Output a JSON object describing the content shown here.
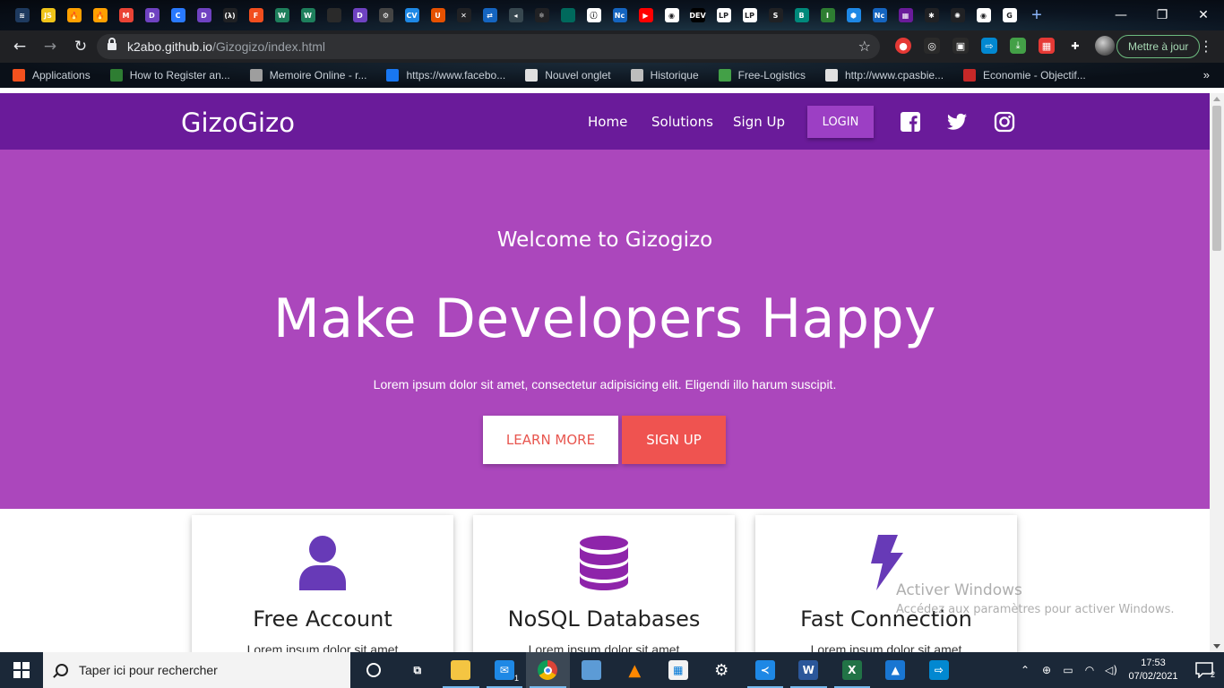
{
  "browser": {
    "tab_icons": [
      {
        "name": "tab-icon-1",
        "color": "#1e3a5f",
        "glyph": "≋"
      },
      {
        "name": "tab-icon-js",
        "color": "#f0c419",
        "glyph": "JS"
      },
      {
        "name": "tab-icon-firebase",
        "color": "#ffa000",
        "glyph": "🔥"
      },
      {
        "name": "tab-icon-firebase-2",
        "color": "#ffa000",
        "glyph": "🔥"
      },
      {
        "name": "tab-icon-gmail",
        "color": "#ea4335",
        "glyph": "M"
      },
      {
        "name": "tab-icon-d1",
        "color": "#6f42c1",
        "glyph": "D"
      },
      {
        "name": "tab-icon-c",
        "color": "#2979ff",
        "glyph": "C"
      },
      {
        "name": "tab-icon-d2",
        "color": "#6f42c1",
        "glyph": "D"
      },
      {
        "name": "tab-icon-lambda",
        "color": "#202124",
        "glyph": "(λ)"
      },
      {
        "name": "tab-icon-figma",
        "color": "#f24e1e",
        "glyph": "F"
      },
      {
        "name": "tab-icon-w1",
        "color": "#1e7f5c",
        "glyph": "W"
      },
      {
        "name": "tab-icon-w2",
        "color": "#1e7f5c",
        "glyph": "W"
      },
      {
        "name": "tab-icon-blank",
        "color": "#2a2a2a",
        "glyph": ""
      },
      {
        "name": "tab-icon-d3",
        "color": "#6f42c1",
        "glyph": "D"
      },
      {
        "name": "tab-icon-gear",
        "color": "#444",
        "glyph": "⚙"
      },
      {
        "name": "tab-icon-cv",
        "color": "#1e88e5",
        "glyph": "CV"
      },
      {
        "name": "tab-icon-u",
        "color": "#e65100",
        "glyph": "U"
      },
      {
        "name": "tab-icon-x",
        "color": "#202124",
        "glyph": "✕"
      },
      {
        "name": "tab-icon-link",
        "color": "#1565c0",
        "glyph": "⇄"
      },
      {
        "name": "tab-icon-arrow",
        "color": "#37474f",
        "glyph": "◂"
      },
      {
        "name": "tab-icon-react",
        "color": "#202124",
        "glyph": "⚛"
      },
      {
        "name": "tab-icon-teal",
        "color": "#00695c",
        "glyph": ""
      },
      {
        "name": "tab-icon-info",
        "color": "#ffffff",
        "glyph": "ⓘ"
      },
      {
        "name": "tab-icon-nc1",
        "color": "#1565c0",
        "glyph": "Nc"
      },
      {
        "name": "tab-icon-youtube",
        "color": "#ff0000",
        "glyph": "▶"
      },
      {
        "name": "tab-icon-globe1",
        "color": "#ffffff",
        "glyph": "◉"
      },
      {
        "name": "tab-icon-dev",
        "color": "#000000",
        "glyph": "DEV"
      },
      {
        "name": "tab-icon-lp1",
        "color": "#ffffff",
        "glyph": "LP"
      },
      {
        "name": "tab-icon-lp2",
        "color": "#ffffff",
        "glyph": "LP"
      },
      {
        "name": "tab-icon-s",
        "color": "#202124",
        "glyph": "S"
      },
      {
        "name": "tab-icon-b",
        "color": "#00897b",
        "glyph": "B"
      },
      {
        "name": "tab-icon-i",
        "color": "#2e7d32",
        "glyph": "I"
      },
      {
        "name": "tab-icon-hex",
        "color": "#1e88e5",
        "glyph": "⬢"
      },
      {
        "name": "tab-icon-nc2",
        "color": "#1565c0",
        "glyph": "Nc"
      },
      {
        "name": "tab-icon-code",
        "color": "#6a1b9a",
        "glyph": "▦"
      },
      {
        "name": "tab-icon-asterisk",
        "color": "#202124",
        "glyph": "✱"
      },
      {
        "name": "tab-icon-spinner",
        "color": "#202124",
        "glyph": "✺"
      },
      {
        "name": "tab-icon-globe2",
        "color": "#ffffff",
        "glyph": "◉"
      },
      {
        "name": "tab-icon-google",
        "color": "#ffffff",
        "glyph": "G"
      }
    ],
    "url_host": "k2abo.github.io",
    "url_path": "/Gizogizo/index.html",
    "update_label": "Mettre à jour",
    "bookmarks": [
      {
        "label": "Applications",
        "color": "#f4511e"
      },
      {
        "label": "How to Register an...",
        "color": "#2e7d32"
      },
      {
        "label": "Memoire Online - r...",
        "color": "#9e9e9e"
      },
      {
        "label": "https://www.facebo...",
        "color": "#1877f2"
      },
      {
        "label": "Nouvel onglet",
        "color": "#e0e0e0"
      },
      {
        "label": "Historique",
        "color": "#bdbdbd"
      },
      {
        "label": "Free-Logistics",
        "color": "#43a047"
      },
      {
        "label": "http://www.cpasbie...",
        "color": "#e0e0e0"
      },
      {
        "label": "Economie - Objectif...",
        "color": "#c62828"
      }
    ]
  },
  "site": {
    "brand": "GizoGizo",
    "nav": [
      "Home",
      "Solutions",
      "Sign Up"
    ],
    "login": "LOGIN",
    "hero": {
      "subtitle": "Welcome to Gizogizo",
      "title": "Make Developers Happy",
      "text": "Lorem ipsum dolor sit amet, consectetur adipisicing elit. Eligendi illo harum suscipit.",
      "learn_more": "LEARN MORE",
      "sign_up": "SIGN UP"
    },
    "cards": [
      {
        "title": "Free Account",
        "text": "Lorem ipsum dolor sit amet",
        "icon": "user-icon"
      },
      {
        "title": "NoSQL Databases",
        "text": "Lorem ipsum dolor sit amet",
        "icon": "database-icon"
      },
      {
        "title": "Fast Connection",
        "text": "Lorem ipsum dolor sit amet",
        "icon": "bolt-icon"
      }
    ],
    "colors": {
      "navbar": "#6a1b9a",
      "hero": "#ab47bc",
      "accent": "#ef5350",
      "icon": "#673ab7"
    }
  },
  "watermark": {
    "title": "Activer Windows",
    "subtitle": "Accédez aux paramètres pour activer Windows."
  },
  "taskbar": {
    "search_placeholder": "Taper ici pour rechercher",
    "time": "17:53",
    "date": "07/02/2021",
    "notification_count": "2",
    "mail_badge": "1"
  }
}
